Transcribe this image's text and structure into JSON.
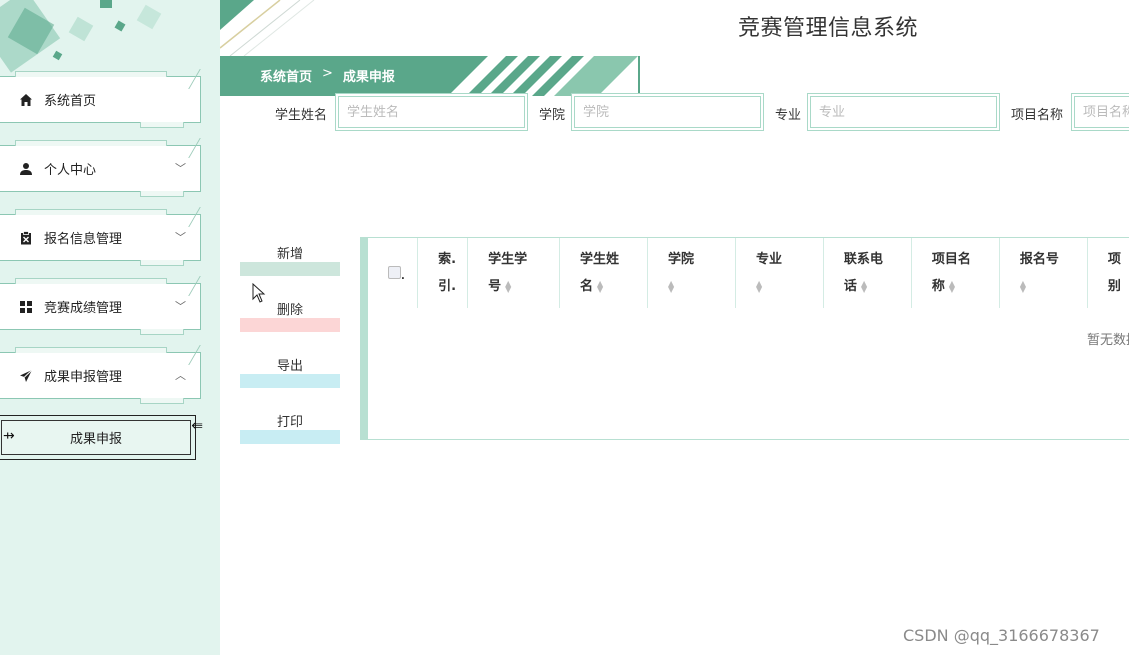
{
  "app": {
    "title": "竞赛管理信息系统"
  },
  "breadcrumb": {
    "home": "系统首页",
    "separator": ">",
    "current": "成果申报"
  },
  "sidebar": {
    "items": [
      {
        "label": "系统首页",
        "icon": "home-icon",
        "expandable": false
      },
      {
        "label": "个人中心",
        "icon": "user-icon",
        "expandable": true,
        "chevron": "﹀"
      },
      {
        "label": "报名信息管理",
        "icon": "clipboard-icon",
        "expandable": true,
        "chevron": "﹀"
      },
      {
        "label": "竞赛成绩管理",
        "icon": "grid-icon",
        "expandable": true,
        "chevron": "﹀"
      },
      {
        "label": "成果申报管理",
        "icon": "send-icon",
        "expandable": true,
        "chevron": "︿"
      }
    ],
    "submenu": [
      {
        "label": "成果申报",
        "active": true
      }
    ]
  },
  "search": {
    "fields": [
      {
        "label": "学生姓名",
        "placeholder": "学生姓名"
      },
      {
        "label": "学院",
        "placeholder": "学院"
      },
      {
        "label": "专业",
        "placeholder": "专业"
      },
      {
        "label": "项目名称",
        "placeholder": "项目名称"
      }
    ]
  },
  "actions": [
    {
      "label": "新增",
      "color": "#cde6dc"
    },
    {
      "label": "删除",
      "color": "#fcd6d6"
    },
    {
      "label": "导出",
      "color": "#c8edf3"
    },
    {
      "label": "打印",
      "color": "#c8edf3"
    }
  ],
  "table": {
    "columns": [
      {
        "l1": "索.",
        "l2": "引.",
        "sortable": false
      },
      {
        "l1": "学生学",
        "l2": "号",
        "sortable": true
      },
      {
        "l1": "学生姓",
        "l2": "名",
        "sortable": true
      },
      {
        "l1": "学院",
        "l2": "",
        "sortable": true
      },
      {
        "l1": "专业",
        "l2": "",
        "sortable": true
      },
      {
        "l1": "联系电",
        "l2": "话",
        "sortable": true
      },
      {
        "l1": "项目名",
        "l2": "称",
        "sortable": true
      },
      {
        "l1": "报名号",
        "l2": "",
        "sortable": true
      },
      {
        "l1": "项",
        "l2": "别",
        "sortable": false
      }
    ],
    "empty_text": "暂无数据"
  },
  "watermark": "CSDN @qq_3166678367",
  "colors": {
    "accent": "#5aa78a",
    "sidebar_bg": "#e2f4ee",
    "border": "#a9d9c8"
  }
}
